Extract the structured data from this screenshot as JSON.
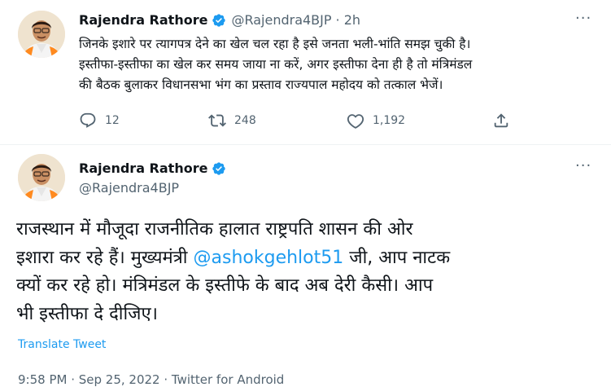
{
  "tweet1": {
    "author_name": "Rajendra Rathore",
    "handle": "@Rajendra4BJP",
    "time": "· 2h",
    "text_line1": "जिनके इशारे पर त्यागपत्र देने का खेल चल रहा है इसे जनता भली-भांति समझ चुकी है।",
    "text_line2": "इस्तीफा-इस्तीफा का खेल कर समय जाया ना करें, अगर इस्तीफा देना ही है तो मंत्रिमंडल",
    "text_line3": "की बैठक बुलाकर विधानसभा भंग का प्रस्ताव राज्यपाल महोदय को तत्काल भेजें।",
    "replies": "12",
    "retweets": "248",
    "likes": "1,192"
  },
  "tweet2": {
    "author_name": "Rajendra Rathore",
    "handle": "@Rajendra4BJP",
    "text_line1": "राजस्थान में मौजूदा राजनीतिक हालात राष्ट्रपति शासन की ओर",
    "text_line2_pre": "इशारा कर रहे हैं। मुख्यमंत्री ",
    "mention": "@ashokgehlot51",
    "text_line2_post": " जी, आप नाटक",
    "text_line3": "क्यों कर रहे हो। मंत्रिमंडल के इस्तीफे के बाद अब देरी कैसी। आप",
    "text_line4": "भी इस्तीफा दे दीजिए।",
    "translate_label": "Translate Tweet",
    "meta": "9:58 PM · Sep 25, 2022 · Twitter for Android"
  },
  "colors": {
    "accent": "#1d9bf0",
    "secondary_text": "#536471",
    "primary_text": "#0f1419"
  }
}
